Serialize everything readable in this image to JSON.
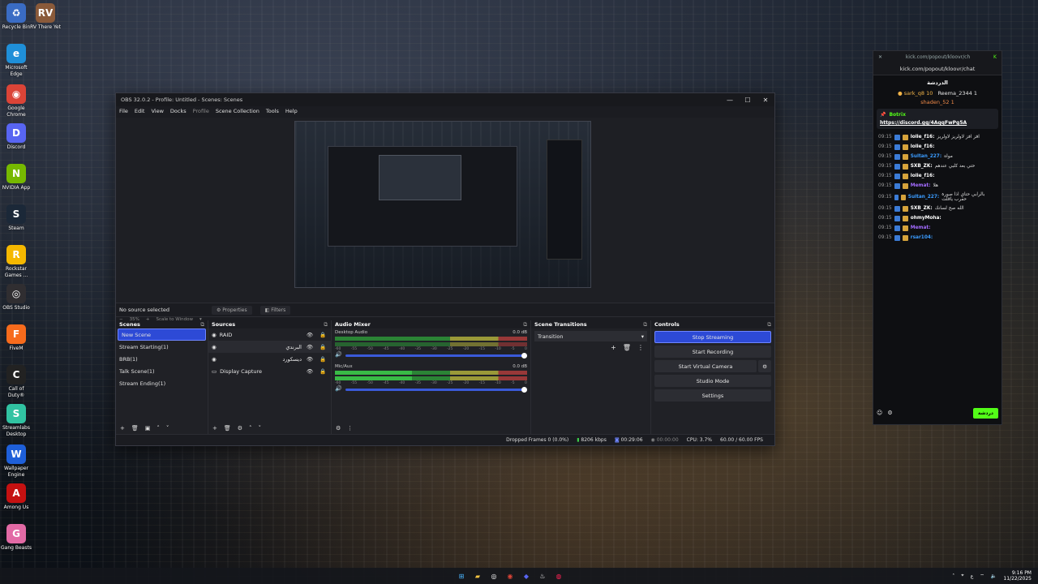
{
  "desktop": {
    "icons": [
      {
        "label": "Recycle Bin",
        "name": "recycle-bin-icon",
        "color": "#3a6cc4",
        "glyph": "♻"
      },
      {
        "label": "RV There Yet",
        "name": "rv-there-yet-icon",
        "color": "#8a5a3a",
        "glyph": "RV"
      },
      {
        "label": "Microsoft Edge",
        "name": "edge-icon",
        "color": "#1f8fd8",
        "glyph": "e"
      },
      {
        "label": "Google Chrome",
        "name": "chrome-icon",
        "color": "#db4437",
        "glyph": "◉"
      },
      {
        "label": "Discord",
        "name": "discord-icon",
        "color": "#5865f2",
        "glyph": "D"
      },
      {
        "label": "NVIDIA App",
        "name": "nvidia-icon",
        "color": "#76b900",
        "glyph": "N"
      },
      {
        "label": "Steam",
        "name": "steam-icon",
        "color": "#1b2838",
        "glyph": "S"
      },
      {
        "label": "Rockstar Games ...",
        "name": "rockstar-icon",
        "color": "#f5b800",
        "glyph": "R"
      },
      {
        "label": "OBS Studio",
        "name": "obs-icon",
        "color": "#302e31",
        "glyph": "◎"
      },
      {
        "label": "FiveM",
        "name": "fivem-icon",
        "color": "#f76b1c",
        "glyph": "F"
      },
      {
        "label": "Call of Duty®",
        "name": "call-of-duty-icon",
        "color": "#222222",
        "glyph": "C"
      },
      {
        "label": "Streamlabs Desktop",
        "name": "streamlabs-icon",
        "color": "#31c3a2",
        "glyph": "S"
      },
      {
        "label": "Wallpaper Engine",
        "name": "wallpaper-engine-icon",
        "color": "#1e5fd9",
        "glyph": "W"
      },
      {
        "label": "Among Us",
        "name": "among-us-icon",
        "color": "#c51111",
        "glyph": "A"
      },
      {
        "label": "Gang Beasts",
        "name": "gang-beasts-icon",
        "color": "#e26aa5",
        "glyph": "G"
      }
    ]
  },
  "obs": {
    "title": "OBS 32.0.2 - Profile: Untitled - Scenes: Scenes",
    "menu": [
      "File",
      "Edit",
      "View",
      "Docks",
      "Profile",
      "Scene Collection",
      "Tools",
      "Help"
    ],
    "zoom": "35%",
    "scale_label": "Scale to Window",
    "no_source": "No source selected",
    "properties": "Properties",
    "filters": "Filters",
    "docks": {
      "scenes": "Scenes",
      "sources": "Sources",
      "mixer": "Audio Mixer",
      "transitions": "Scene Transitions",
      "controls": "Controls"
    },
    "scenes": [
      "New Scene",
      "Stream Starting(1)",
      "BRB(1)",
      "Talk Scene(1)",
      "Stream Ending(1)"
    ],
    "sources": [
      "RAID",
      "البرندي",
      "ديسكورد",
      "Display Capture"
    ],
    "mixer": {
      "desktop": {
        "name": "Desktop Audio",
        "db": "0.0 dB"
      },
      "mic": {
        "name": "Mic/Aux",
        "db": "0.0 dB"
      },
      "ticks": [
        "-60",
        "-55",
        "-50",
        "-45",
        "-40",
        "-35",
        "-30",
        "-25",
        "-20",
        "-15",
        "-10",
        "-5",
        "0"
      ]
    },
    "transition": "Transition",
    "controls": [
      "Stop Streaming",
      "Start Recording",
      "Start Virtual Camera",
      "Studio Mode",
      "Settings"
    ],
    "status": {
      "dropped": "Dropped Frames 0 (0.0%)",
      "bitrate": "8206 kbps",
      "live": "00:29:06",
      "rec": "00:00:00",
      "cpu": "CPU: 3.7%",
      "fps": "60.00 / 60.00 FPS"
    }
  },
  "chat": {
    "url_short": "kick.com/popout/kloovr/ch",
    "url": "kick.com/popout/kloovr/chat",
    "section_title": "الدردشة",
    "leaderboard": [
      {
        "user": "sark_q8",
        "count": "10"
      },
      {
        "user": "Reema_2344",
        "count": "1"
      },
      {
        "user": "shaden_52",
        "count": "1"
      }
    ],
    "pinned_by": "Botrix",
    "pinned_link": "https://discord.gg/4AqqFwPg5A",
    "messages": [
      {
        "time": "09:15",
        "user": "lolie_f16:",
        "text": "افز افز لاولريز لاولريز",
        "color": "#ffffff"
      },
      {
        "time": "09:15",
        "user": "lolie_f16:",
        "text": "",
        "color": "#ffffff"
      },
      {
        "time": "09:15",
        "user": "Sultan_227:",
        "text": "مواه",
        "color": "#3b9cff"
      },
      {
        "time": "09:15",
        "user": "SXB_ZK:",
        "text": "حتي بعد كلبي عندهم",
        "color": "#ffffff"
      },
      {
        "time": "09:15",
        "user": "lolie_f16:",
        "text": "",
        "color": "#ffffff"
      },
      {
        "time": "09:15",
        "user": "Memat:",
        "text": "هلا",
        "color": "#a36bff"
      },
      {
        "time": "09:15",
        "user": "Sultan_227:",
        "text": "بالرابي حتاي اذا صورة حقرب ياقلت",
        "color": "#3b9cff"
      },
      {
        "time": "09:15",
        "user": "SXB_ZK:",
        "text": "الله صح لسانك",
        "color": "#ffffff"
      },
      {
        "time": "09:15",
        "user": "ohmyMoha:",
        "text": "",
        "color": "#ffffff"
      },
      {
        "time": "09:15",
        "user": "Memat:",
        "text": "",
        "color": "#a36bff"
      },
      {
        "time": "09:15",
        "user": "rsar104:",
        "text": "",
        "color": "#3b9cff"
      }
    ],
    "send": "دردشة"
  },
  "taskbar": {
    "time": "9:16 PM",
    "date": "11/22/2025"
  }
}
